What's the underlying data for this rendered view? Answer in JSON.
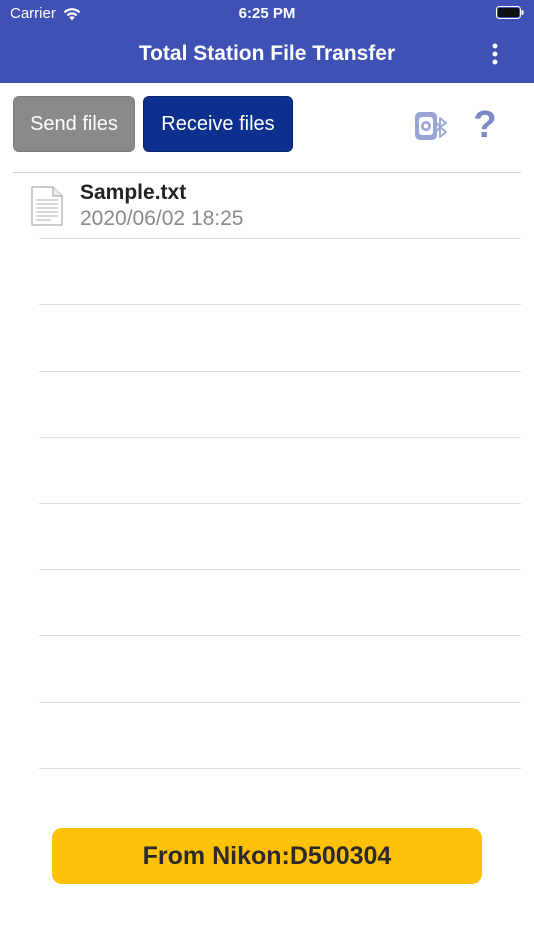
{
  "status_bar": {
    "carrier": "Carrier",
    "time": "6:25 PM"
  },
  "app_bar": {
    "title": "Total Station File Transfer",
    "menu_icon": "more-vert-icon"
  },
  "toolbar": {
    "send_label": "Send files",
    "receive_label": "Receive files",
    "bluetooth_icon": "bluetooth-device-icon",
    "help_icon": "help-icon",
    "help_glyph": "?"
  },
  "files": [
    {
      "name": "Sample.txt",
      "date": "2020/06/02 18:25",
      "icon": "text-document-icon"
    }
  ],
  "device_banner": {
    "text": "From Nikon:D500304"
  },
  "colors": {
    "app_bar": "#3F51B5",
    "send_button": "#8a8a8a",
    "receive_button": "#0D2F8E",
    "banner": "#FFC107"
  }
}
